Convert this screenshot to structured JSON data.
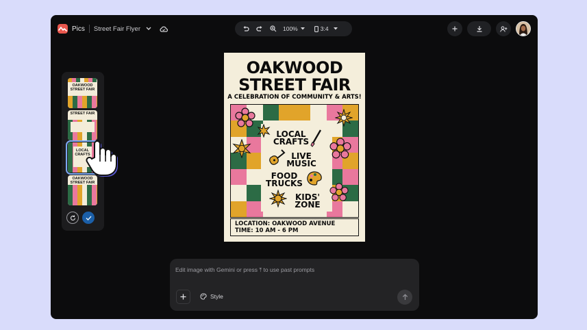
{
  "header": {
    "app_name": "Pics",
    "file_name": "Street Fair Flyer",
    "zoom": "100%",
    "aspect_ratio": "3:4"
  },
  "thumbnails": [
    {
      "title": "OAKWOOD STREET FAIR"
    },
    {
      "title": "STREET FAIR"
    },
    {
      "title": "LOCAL CRAFTS"
    },
    {
      "title": "OAKWOOD STREET FAIR"
    }
  ],
  "poster": {
    "title_line1": "OAKWOOD",
    "title_line2": "STREET FAIR",
    "subtitle": "A CELEBRATION OF COMMUNITY & ARTS!",
    "features": [
      "LOCAL CRAFTS",
      "LIVE MUSIC",
      "FOOD TRUCKS",
      "KIDS' ZONE"
    ],
    "location": "LOCATION: OAKWOOD AVENUE",
    "time": "TIME: 10 AM - 6 PM"
  },
  "prompt": {
    "placeholder": "Edit image with Gemini or press ⤒ to use past prompts",
    "style_label": "Style"
  },
  "colors": {
    "background": "#d9dcfb",
    "window": "#0c0c0d",
    "accent": "#1b5fa8",
    "poster_green": "#2c6b45",
    "poster_pink": "#e9789d",
    "poster_yellow": "#e1a42a",
    "poster_cream": "#f4eedb"
  }
}
